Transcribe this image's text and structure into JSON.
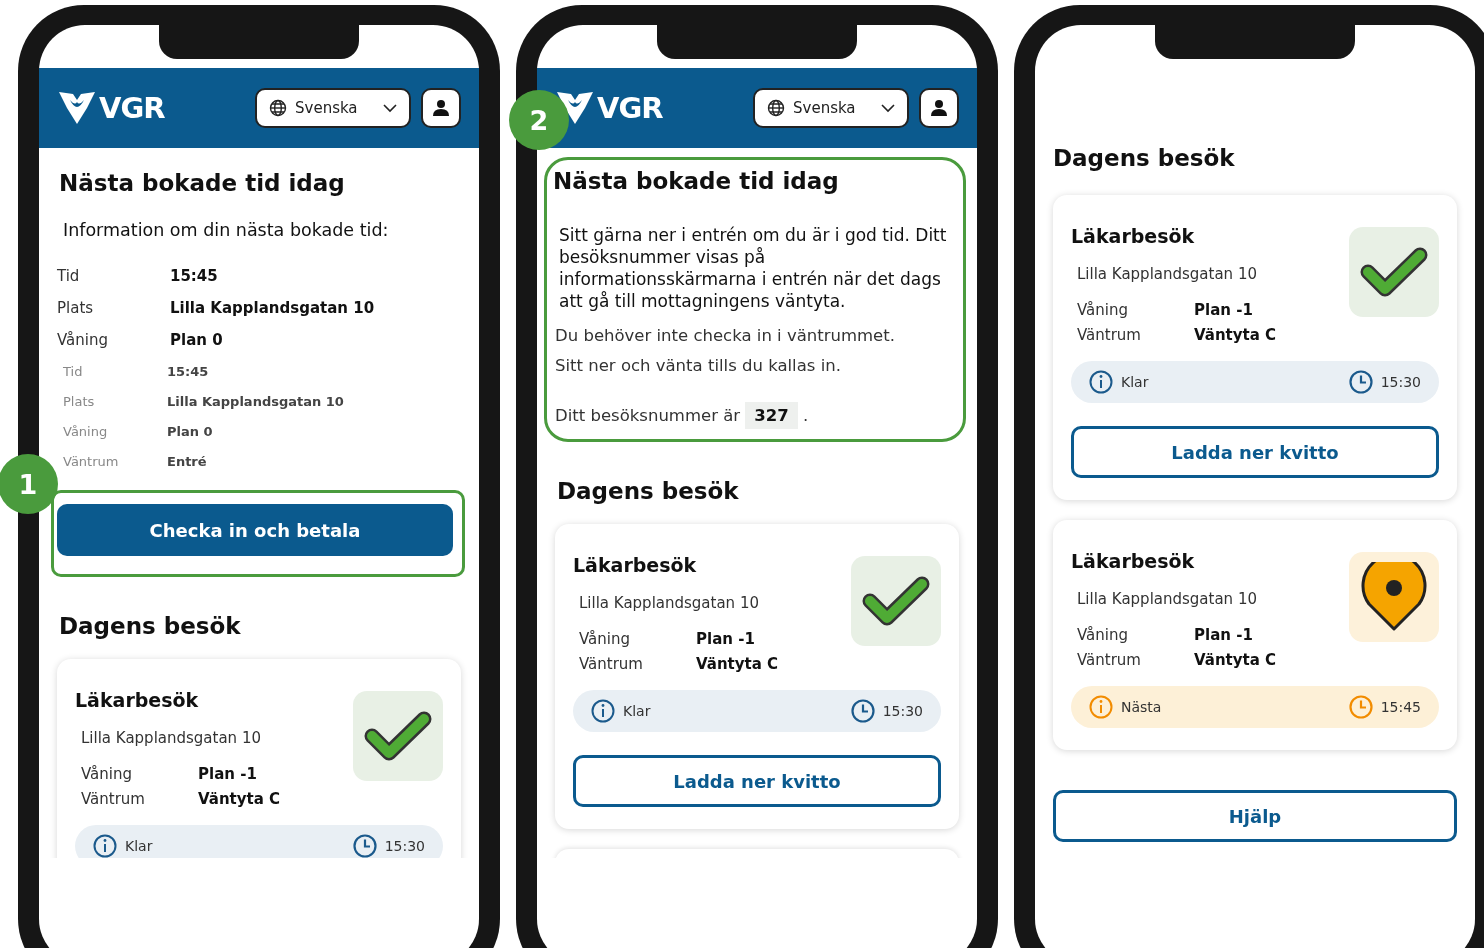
{
  "phones": [
    {
      "header": {
        "logo": "VGR",
        "language": "Svenska"
      },
      "next_booking": {
        "kind": "button",
        "badge": "1",
        "title": "Nästa bokade tid idag",
        "intro": "Information om din nästa bokade tid:",
        "details": [
          {
            "label": "Tid",
            "value": "15:45"
          },
          {
            "label": "Plats",
            "value": "Lilla Kapplandsgatan 10"
          },
          {
            "label": "Våning",
            "value": "Plan 0"
          }
        ],
        "blurred_details": [
          {
            "label": "Tid",
            "value": "15:45"
          },
          {
            "label": "Plats",
            "value": "Lilla Kapplandsgatan 10"
          },
          {
            "label": "Våning",
            "value": "Plan 0"
          },
          {
            "label": "Väntrum",
            "value": "Entré"
          }
        ],
        "button": "Checka in och betala"
      },
      "visits": {
        "title": "Dagens besök",
        "cards": [
          {
            "title": "Läkarbesök",
            "address": "Lilla Kapplandsgatan 10",
            "rows": [
              {
                "label": "Våning",
                "value": "Plan -1"
              },
              {
                "label": "Väntrum",
                "value": "Väntyta C"
              }
            ],
            "status": {
              "kind": "done",
              "label": "Klar",
              "time": "15:30"
            }
          }
        ]
      }
    },
    {
      "header": {
        "logo": "VGR",
        "language": "Svenska"
      },
      "next_booking": {
        "kind": "section",
        "badge": "2",
        "title": "Nästa bokade tid idag",
        "paragraphs": [
          "Sitt gärna ner i entrén om du är i god tid. Ditt besöksnummer visas på informationsskärmarna i entrén när det dags att gå till mottagningens väntyta.",
          "Du behöver inte checka in i väntrummet.",
          "Sitt ner och vänta tills du kallas in."
        ],
        "number_text": "Ditt besöksnummer är **327** ."
      },
      "visits": {
        "title": "Dagens besök",
        "more_below": true,
        "cards": [
          {
            "title": "Läkarbesök",
            "address": "Lilla Kapplandsgatan 10",
            "rows": [
              {
                "label": "Våning",
                "value": "Plan -1"
              },
              {
                "label": "Väntrum",
                "value": "Väntyta C"
              }
            ],
            "status": {
              "kind": "done",
              "label": "Klar",
              "time": "15:30"
            },
            "button": "Ladda ner kvitto"
          }
        ]
      }
    },
    {
      "visits": {
        "title": "Dagens besök",
        "help_button": "Hjälp",
        "cards": [
          {
            "title": "Läkarbesök",
            "address": "Lilla Kapplandsgatan 10",
            "rows": [
              {
                "label": "Våning",
                "value": "Plan -1"
              },
              {
                "label": "Väntrum",
                "value": "Väntyta C"
              }
            ],
            "status": {
              "kind": "done",
              "label": "Klar",
              "time": "15:30"
            },
            "button": "Ladda ner kvitto"
          },
          {
            "title": "Läkarbesök",
            "address": "Lilla Kapplandsgatan 10",
            "rows": [
              {
                "label": "Våning",
                "value": "Plan -1"
              },
              {
                "label": "Väntrum",
                "value": "Väntyta C"
              }
            ],
            "status": {
              "kind": "next",
              "label": "Nästa",
              "time": "15:45"
            }
          }
        ]
      }
    }
  ]
}
